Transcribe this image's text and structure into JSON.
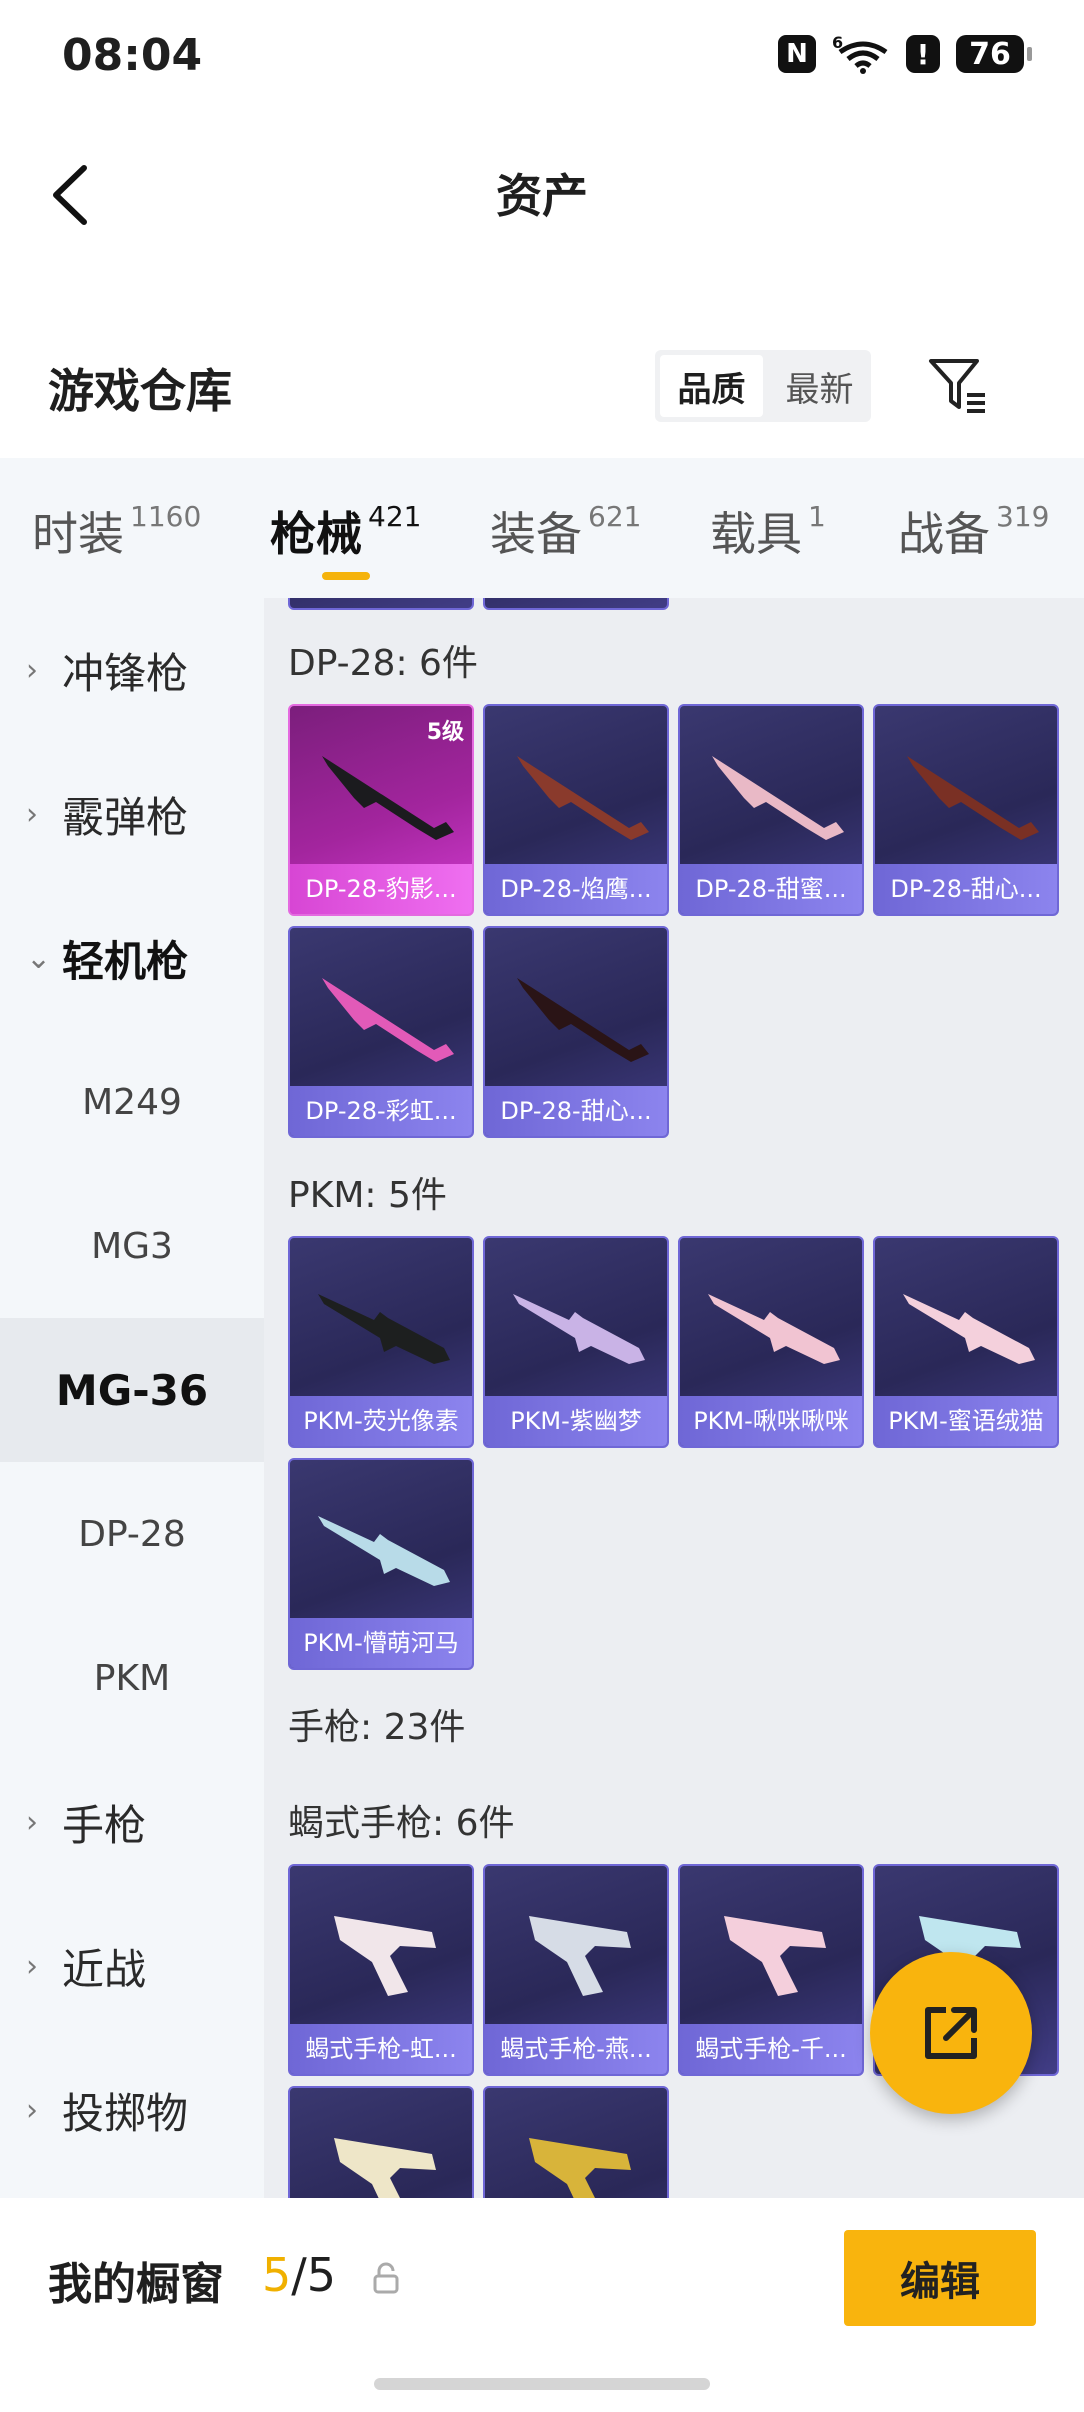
{
  "status": {
    "time": "08:04",
    "nfc": "N",
    "network": "6",
    "alert": "!",
    "battery": "76"
  },
  "nav": {
    "back_icon": "chevron-left-icon",
    "title": "资产"
  },
  "warehouse": {
    "title": "游戏仓库",
    "sort": [
      "品质",
      "最新"
    ],
    "active_sort": "品质",
    "filter_icon": "filter-icon"
  },
  "tabs": [
    {
      "label": "时装",
      "count": "1160"
    },
    {
      "label": "枪械",
      "count": "421"
    },
    {
      "label": "装备",
      "count": "621"
    },
    {
      "label": "载具",
      "count": "1"
    },
    {
      "label": "战备",
      "count": "319"
    }
  ],
  "sidebar": {
    "categories": [
      "冲锋枪",
      "霰弹枪",
      "轻机枪",
      "手枪",
      "近战",
      "投掷物"
    ],
    "subitems": [
      "M249",
      "MG3",
      "MG-36",
      "DP-28",
      "PKM"
    ]
  },
  "content": {
    "dp28": {
      "title": "DP-28: 6件",
      "items": [
        {
          "name": "DP-28-豹影...",
          "level": "5级"
        },
        {
          "name": "DP-28-焰鹰..."
        },
        {
          "name": "DP-28-甜蜜..."
        },
        {
          "name": "DP-28-甜心..."
        },
        {
          "name": "DP-28-彩虹..."
        },
        {
          "name": "DP-28-甜心..."
        }
      ]
    },
    "pkm": {
      "title": "PKM: 5件",
      "items": [
        {
          "name": "PKM-荧光像素"
        },
        {
          "name": "PKM-紫幽梦"
        },
        {
          "name": "PKM-啾咪啾咪"
        },
        {
          "name": "PKM-蜜语绒猫"
        },
        {
          "name": "PKM-懵萌河马"
        }
      ]
    },
    "pistol_title": "手枪: 23件",
    "scorpion": {
      "title": "蝎式手枪: 6件",
      "items": [
        {
          "name": "蝎式手枪-虹..."
        },
        {
          "name": "蝎式手枪-燕..."
        },
        {
          "name": "蝎式手枪-千..."
        }
      ]
    }
  },
  "fab_icon": "share-external-icon",
  "bottom": {
    "title": "我的橱窗",
    "count_current": "5",
    "count_total": "/5",
    "lock_icon": "lock-icon",
    "edit_label": "编辑"
  },
  "colors": {
    "accent": "#f9b40d",
    "card_purple": "#2a2858",
    "card_pink": "#a3259e"
  }
}
